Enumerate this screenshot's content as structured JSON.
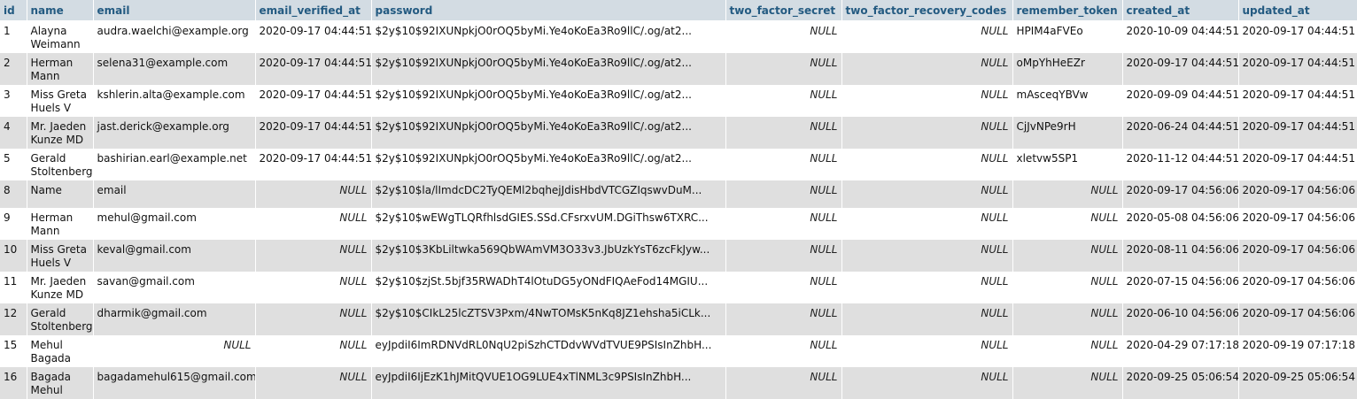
{
  "columns": [
    "id",
    "name",
    "email",
    "email_verified_at",
    "password",
    "two_factor_secret",
    "two_factor_recovery_codes",
    "remember_token",
    "created_at",
    "updated_at"
  ],
  "rows": [
    {
      "id": "1",
      "name": "Alayna Weimann",
      "email": "audra.waelchi@example.org",
      "email_verified_at": "2020-09-17 04:44:51",
      "password": "$2y$10$92IXUNpkjO0rOQ5byMi.Ye4oKoEa3Ro9llC/.og/at2...",
      "two_factor_secret": "NULL",
      "two_factor_recovery_codes": "NULL",
      "remember_token": "HPIM4aFVEo",
      "created_at": "2020-10-09 04:44:51",
      "updated_at": "2020-09-17 04:44:51"
    },
    {
      "id": "2",
      "name": "Herman Mann",
      "email": "selena31@example.com",
      "email_verified_at": "2020-09-17 04:44:51",
      "password": "$2y$10$92IXUNpkjO0rOQ5byMi.Ye4oKoEa3Ro9llC/.og/at2...",
      "two_factor_secret": "NULL",
      "two_factor_recovery_codes": "NULL",
      "remember_token": "oMpYhHeEZr",
      "created_at": "2020-09-17 04:44:51",
      "updated_at": "2020-09-17 04:44:51"
    },
    {
      "id": "3",
      "name": "Miss Greta Huels V",
      "email": "kshlerin.alta@example.com",
      "email_verified_at": "2020-09-17 04:44:51",
      "password": "$2y$10$92IXUNpkjO0rOQ5byMi.Ye4oKoEa3Ro9llC/.og/at2...",
      "two_factor_secret": "NULL",
      "two_factor_recovery_codes": "NULL",
      "remember_token": "mAsceqYBVw",
      "created_at": "2020-09-09 04:44:51",
      "updated_at": "2020-09-17 04:44:51"
    },
    {
      "id": "4",
      "name": "Mr. Jaeden Kunze MD",
      "email": "jast.derick@example.org",
      "email_verified_at": "2020-09-17 04:44:51",
      "password": "$2y$10$92IXUNpkjO0rOQ5byMi.Ye4oKoEa3Ro9llC/.og/at2...",
      "two_factor_secret": "NULL",
      "two_factor_recovery_codes": "NULL",
      "remember_token": "CjJvNPe9rH",
      "created_at": "2020-06-24 04:44:51",
      "updated_at": "2020-09-17 04:44:51"
    },
    {
      "id": "5",
      "name": "Gerald Stoltenberg",
      "email": "bashirian.earl@example.net",
      "email_verified_at": "2020-09-17 04:44:51",
      "password": "$2y$10$92IXUNpkjO0rOQ5byMi.Ye4oKoEa3Ro9llC/.og/at2...",
      "two_factor_secret": "NULL",
      "two_factor_recovery_codes": "NULL",
      "remember_token": "xletvw5SP1",
      "created_at": "2020-11-12 04:44:51",
      "updated_at": "2020-09-17 04:44:51"
    },
    {
      "id": "8",
      "name": "Name",
      "email": "email",
      "email_verified_at": "NULL",
      "password": "$2y$10$la/lImdcDC2TyQEMl2bqhejJdisHbdVTCGZIqswvDuM...",
      "two_factor_secret": "NULL",
      "two_factor_recovery_codes": "NULL",
      "remember_token": "NULL",
      "created_at": "2020-09-17 04:56:06",
      "updated_at": "2020-09-17 04:56:06"
    },
    {
      "id": "9",
      "name": "Herman Mann",
      "email": "mehul@gmail.com",
      "email_verified_at": "NULL",
      "password": "$2y$10$wEWgTLQRfhlsdGIES.SSd.CFsrxvUM.DGiThsw6TXRC...",
      "two_factor_secret": "NULL",
      "two_factor_recovery_codes": "NULL",
      "remember_token": "NULL",
      "created_at": "2020-05-08 04:56:06",
      "updated_at": "2020-09-17 04:56:06"
    },
    {
      "id": "10",
      "name": "Miss Greta Huels V",
      "email": "keval@gmail.com",
      "email_verified_at": "NULL",
      "password": "$2y$10$3KbLiltwka569QbWAmVM3O33v3.JbUzkYsT6zcFkJyw...",
      "two_factor_secret": "NULL",
      "two_factor_recovery_codes": "NULL",
      "remember_token": "NULL",
      "created_at": "2020-08-11 04:56:06",
      "updated_at": "2020-09-17 04:56:06"
    },
    {
      "id": "11",
      "name": "Mr. Jaeden Kunze MD",
      "email": "savan@gmail.com",
      "email_verified_at": "NULL",
      "password": "$2y$10$zjSt.5bjf35RWADhT4lOtuDG5yONdFIQAeFod14MGIU...",
      "two_factor_secret": "NULL",
      "two_factor_recovery_codes": "NULL",
      "remember_token": "NULL",
      "created_at": "2020-07-15 04:56:06",
      "updated_at": "2020-09-17 04:56:06"
    },
    {
      "id": "12",
      "name": "Gerald Stoltenberg",
      "email": "dharmik@gmail.com",
      "email_verified_at": "NULL",
      "password": "$2y$10$CIkL25lcZTSV3Pxm/4NwTOMsK5nKq8JZ1ehsha5iCLk...",
      "two_factor_secret": "NULL",
      "two_factor_recovery_codes": "NULL",
      "remember_token": "NULL",
      "created_at": "2020-06-10 04:56:06",
      "updated_at": "2020-09-17 04:56:06"
    },
    {
      "id": "15",
      "name": "Mehul Bagada",
      "email": "NULL",
      "email_verified_at": "NULL",
      "password": "eyJpdiI6ImRDNVdRL0NqU2piSzhCTDdvWVdTVUE9PSIsInZhbH...",
      "two_factor_secret": "NULL",
      "two_factor_recovery_codes": "NULL",
      "remember_token": "NULL",
      "created_at": "2020-04-29 07:17:18",
      "updated_at": "2020-09-19 07:17:18"
    },
    {
      "id": "16",
      "name": "Bagada Mehul",
      "email": "bagadamehul615@gmail.com",
      "email_verified_at": "NULL",
      "password": "eyJpdiI6IjEzK1hJMitQVUE1OG9LUE4xTlNML3c9PSIsInZhbH...",
      "two_factor_secret": "NULL",
      "two_factor_recovery_codes": "NULL",
      "remember_token": "NULL",
      "created_at": "2020-09-25 05:06:54",
      "updated_at": "2020-09-25 05:06:54"
    }
  ]
}
